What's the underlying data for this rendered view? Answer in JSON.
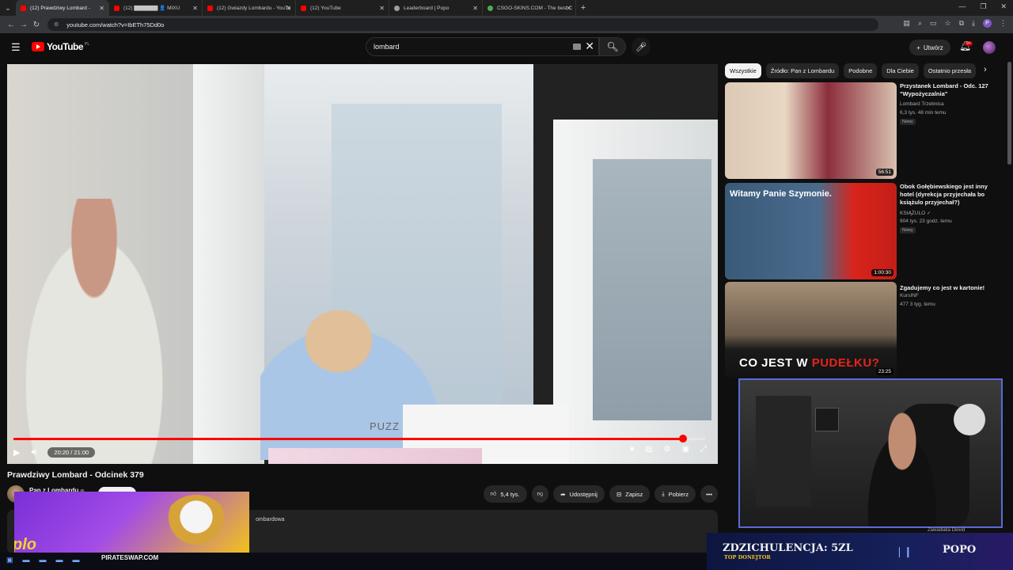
{
  "browser": {
    "tabs": [
      {
        "label": "(12) Prawdziwy Lombard -",
        "active": true,
        "favicon": "youtube"
      },
      {
        "label": "(12) ▇▇▇▇▇▇ 👤 MIXU",
        "active": false,
        "favicon": "youtube"
      },
      {
        "label": "(12) Gwiazdy Lombardu - YouTu",
        "active": false,
        "favicon": "youtube"
      },
      {
        "label": "(12) YouTube",
        "active": false,
        "favicon": "youtube"
      },
      {
        "label": "Leaderboard | Popo",
        "active": false,
        "favicon": "globe"
      },
      {
        "label": "CSGO-SKINS.COM - The best C",
        "active": false,
        "favicon": "green"
      }
    ],
    "url": "youtube.com/watch?v=IbETh75Dd0o"
  },
  "youtube": {
    "logo_text": "YouTube",
    "logo_country": "PL",
    "search_value": "lombard",
    "create_label": "Utwórz",
    "notification_count": "9+"
  },
  "player": {
    "time_display": "20:20 / 21:00",
    "progress_fraction": 0.968,
    "scene_label": "PUZZ"
  },
  "video": {
    "title": "Prawdziwy Lombard - Odcinek 379",
    "channel": "Pan z Lombardu",
    "likes": "5,4 tys.",
    "share_label": "Udostępnij",
    "save_label": "Zapisz",
    "download_label": "Pobierz",
    "description_snippet": "ombardowa"
  },
  "sidebar": {
    "chips": [
      "Wszystkie",
      "Źródło: Pan z Lombardu",
      "Podobne",
      "Dla Ciebie",
      "Ostatnio przesła"
    ],
    "recommendations": [
      {
        "title": "Przystanek Lombard - Odc. 127 \"Wypożyczalnia\"",
        "channel": "Lombard Trzebnica",
        "meta": "6,3 tys.  48 min temu",
        "badge": "Nowy",
        "duration": "56:51"
      },
      {
        "title": "Obok Gołębiewskiego jest inny hotel (dyrekcja przyjechała bo książulo przyjechał?)",
        "channel": "KSIĄŻULO ✓",
        "meta": "904 tys.  23 godz. temu",
        "badge": "Nowy",
        "duration": "1:00:30",
        "thumb_text": "Witamy Panie Szymonie."
      },
      {
        "title": "Zgadujemy co jest w kartonie!",
        "channel": "KursINF",
        "meta": "477  3 tyg. temu",
        "badge": "",
        "duration": "23:25",
        "thumb_text_a": "CO JEST W ",
        "thumb_text_b": "PUDEŁKU?"
      }
    ]
  },
  "overlays": {
    "promo_word": "plo",
    "taskbar_url": "PIRATESWAP.COM",
    "donor_main": "ZDZICHULENCJA: 5ZL",
    "donor_sub": "TOP DONEJTOR",
    "donor_name": "POPO",
    "under_cam_text": "Zawadiaka Deivid"
  }
}
